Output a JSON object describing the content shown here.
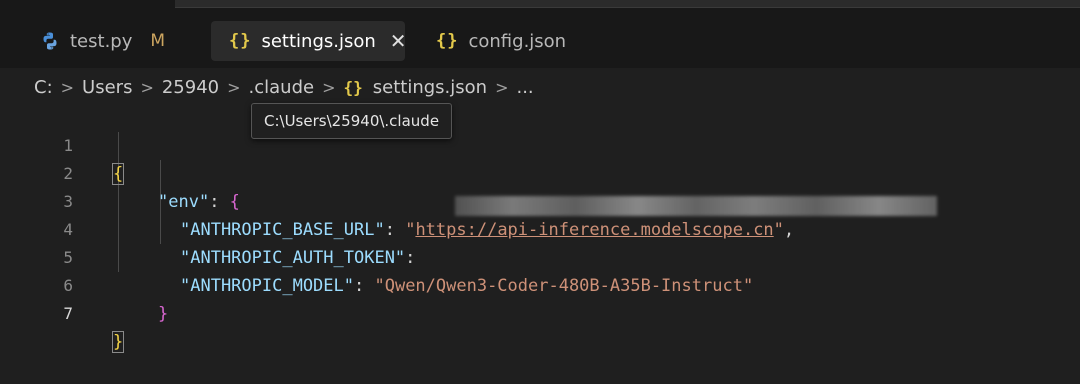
{
  "tabs": [
    {
      "label": "test.py",
      "badge": "M",
      "icon": "python-icon"
    },
    {
      "label": "settings.json",
      "icon": "json-braces-icon",
      "active": true,
      "close": "✕"
    },
    {
      "label": "config.json",
      "icon": "json-braces-icon"
    }
  ],
  "breadcrumb": {
    "items": [
      "C:",
      "Users",
      "25940",
      ".claude",
      "settings.json",
      "..."
    ],
    "file_icon": "{}"
  },
  "tooltip": "C:\\Users\\25940\\.claude",
  "editor": {
    "line_numbers": [
      "1",
      "2",
      "3",
      "4",
      "5",
      "6",
      "7"
    ],
    "current_line": "7",
    "lines": {
      "l1_open": "{",
      "l2_key": "\"env\"",
      "l2_colon": ": ",
      "l2_brace": "{",
      "l3_key": "\"ANTHROPIC_BASE_URL\"",
      "l3_colon": ": ",
      "l3_q1": "\"",
      "l3_url": "https://api-inference.modelscope.cn",
      "l3_q2": "\"",
      "l3_comma": ",",
      "l4_key": "\"ANTHROPIC_AUTH_TOKEN\"",
      "l4_colon": ":",
      "l5_key": "\"ANTHROPIC_MODEL\"",
      "l5_colon": ": ",
      "l5_value": "\"Qwen/Qwen3-Coder-480B-A35B-Instruct\"",
      "l6_close": "}",
      "l7_close": "}"
    }
  },
  "colors": {
    "key": "#9cdcfe",
    "string": "#ce9178",
    "brace_level1": "#f5d547",
    "brace_level2": "#d966d1",
    "json_icon": "#e3c94b",
    "modified_badge": "#cca560"
  }
}
